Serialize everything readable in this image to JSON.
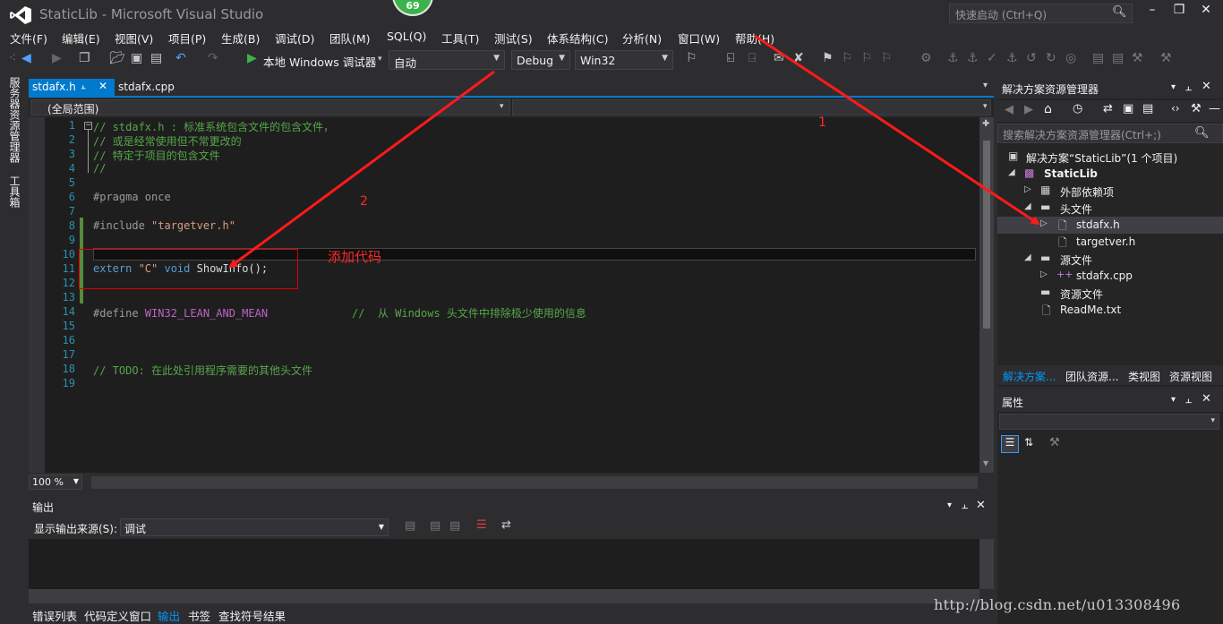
{
  "window": {
    "title": "StaticLib - Microsoft Visual Studio",
    "notification_badge": "69",
    "quick_launch_placeholder": "快速启动 (Ctrl+Q)"
  },
  "menu": [
    "文件(F)",
    "编辑(E)",
    "视图(V)",
    "项目(P)",
    "生成(B)",
    "调试(D)",
    "团队(M)",
    "SQL(Q)",
    "工具(T)",
    "测试(S)",
    "体系结构(C)",
    "分析(N)",
    "窗口(W)",
    "帮助(H)"
  ],
  "toolbar": {
    "run_target": "本地 Windows 调试器",
    "run_mode": "自动",
    "configuration": "Debug",
    "platform": "Win32"
  },
  "left_tabs": [
    "服务器资源管理器",
    "工具箱"
  ],
  "editor": {
    "tabs": [
      "stdafx.h",
      "stdafx.cpp"
    ],
    "active_tab": "stdafx.h",
    "scope": "(全局范围)",
    "zoom": "100 %",
    "lines": [
      {
        "n": "1",
        "text": "// stdafx.h : 标准系统包含文件的包含文件，"
      },
      {
        "n": "2",
        "text": "// 或是经常使用但不常更改的"
      },
      {
        "n": "3",
        "text": "// 特定于项目的包含文件"
      },
      {
        "n": "4",
        "text": "//"
      },
      {
        "n": "5",
        "text": ""
      },
      {
        "n": "6",
        "text": "#pragma once"
      },
      {
        "n": "7",
        "text": ""
      },
      {
        "n": "8",
        "text_pp": "#include ",
        "text_str": "\"targetver.h\""
      },
      {
        "n": "9",
        "text": ""
      },
      {
        "n": "10",
        "text": ""
      },
      {
        "n": "11",
        "kw1": "extern",
        "str": " \"C\" ",
        "kw2": "void",
        "rest": " ShowInfo();"
      },
      {
        "n": "12",
        "text": ""
      },
      {
        "n": "13",
        "text": ""
      },
      {
        "n": "14",
        "pp": "#define ",
        "mac": "WIN32_LEAN_AND_MEAN",
        "cmt": "             //  从 Windows 头文件中排除极少使用的信息"
      },
      {
        "n": "15",
        "text": ""
      },
      {
        "n": "16",
        "text": ""
      },
      {
        "n": "17",
        "text": ""
      },
      {
        "n": "18",
        "text": "// TODO: 在此处引用程序需要的其他头文件"
      },
      {
        "n": "19",
        "text": ""
      }
    ]
  },
  "annotations": {
    "box_label": "添加代码",
    "marker1": "1",
    "marker2": "2"
  },
  "output": {
    "title": "输出",
    "source_label": "显示输出来源(S):",
    "source_value": "调试"
  },
  "bottom_tabs": [
    "错误列表",
    "代码定义窗口",
    "输出",
    "书签",
    "查找符号结果"
  ],
  "active_bottom_tab": "输出",
  "solution_explorer": {
    "title": "解决方案资源管理器",
    "search_placeholder": "搜索解决方案资源管理器(Ctrl+;)",
    "tree": [
      {
        "label": "解决方案“StaticLib”(1 个项目)"
      },
      {
        "label": "StaticLib"
      },
      {
        "label": "外部依赖项"
      },
      {
        "label": "头文件"
      },
      {
        "label": "stdafx.h"
      },
      {
        "label": "targetver.h"
      },
      {
        "label": "源文件"
      },
      {
        "label": "stdafx.cpp"
      },
      {
        "label": "资源文件"
      },
      {
        "label": "ReadMe.txt"
      }
    ],
    "tabs": [
      "解决方案...",
      "团队资源...",
      "类视图",
      "资源视图"
    ]
  },
  "properties": {
    "title": "属性"
  },
  "watermark": "http://blog.csdn.net/u013308496",
  "colors": {
    "accent": "#007acc",
    "annotation": "#ff0000",
    "comment": "#57a64a",
    "keyword": "#569cd6"
  }
}
